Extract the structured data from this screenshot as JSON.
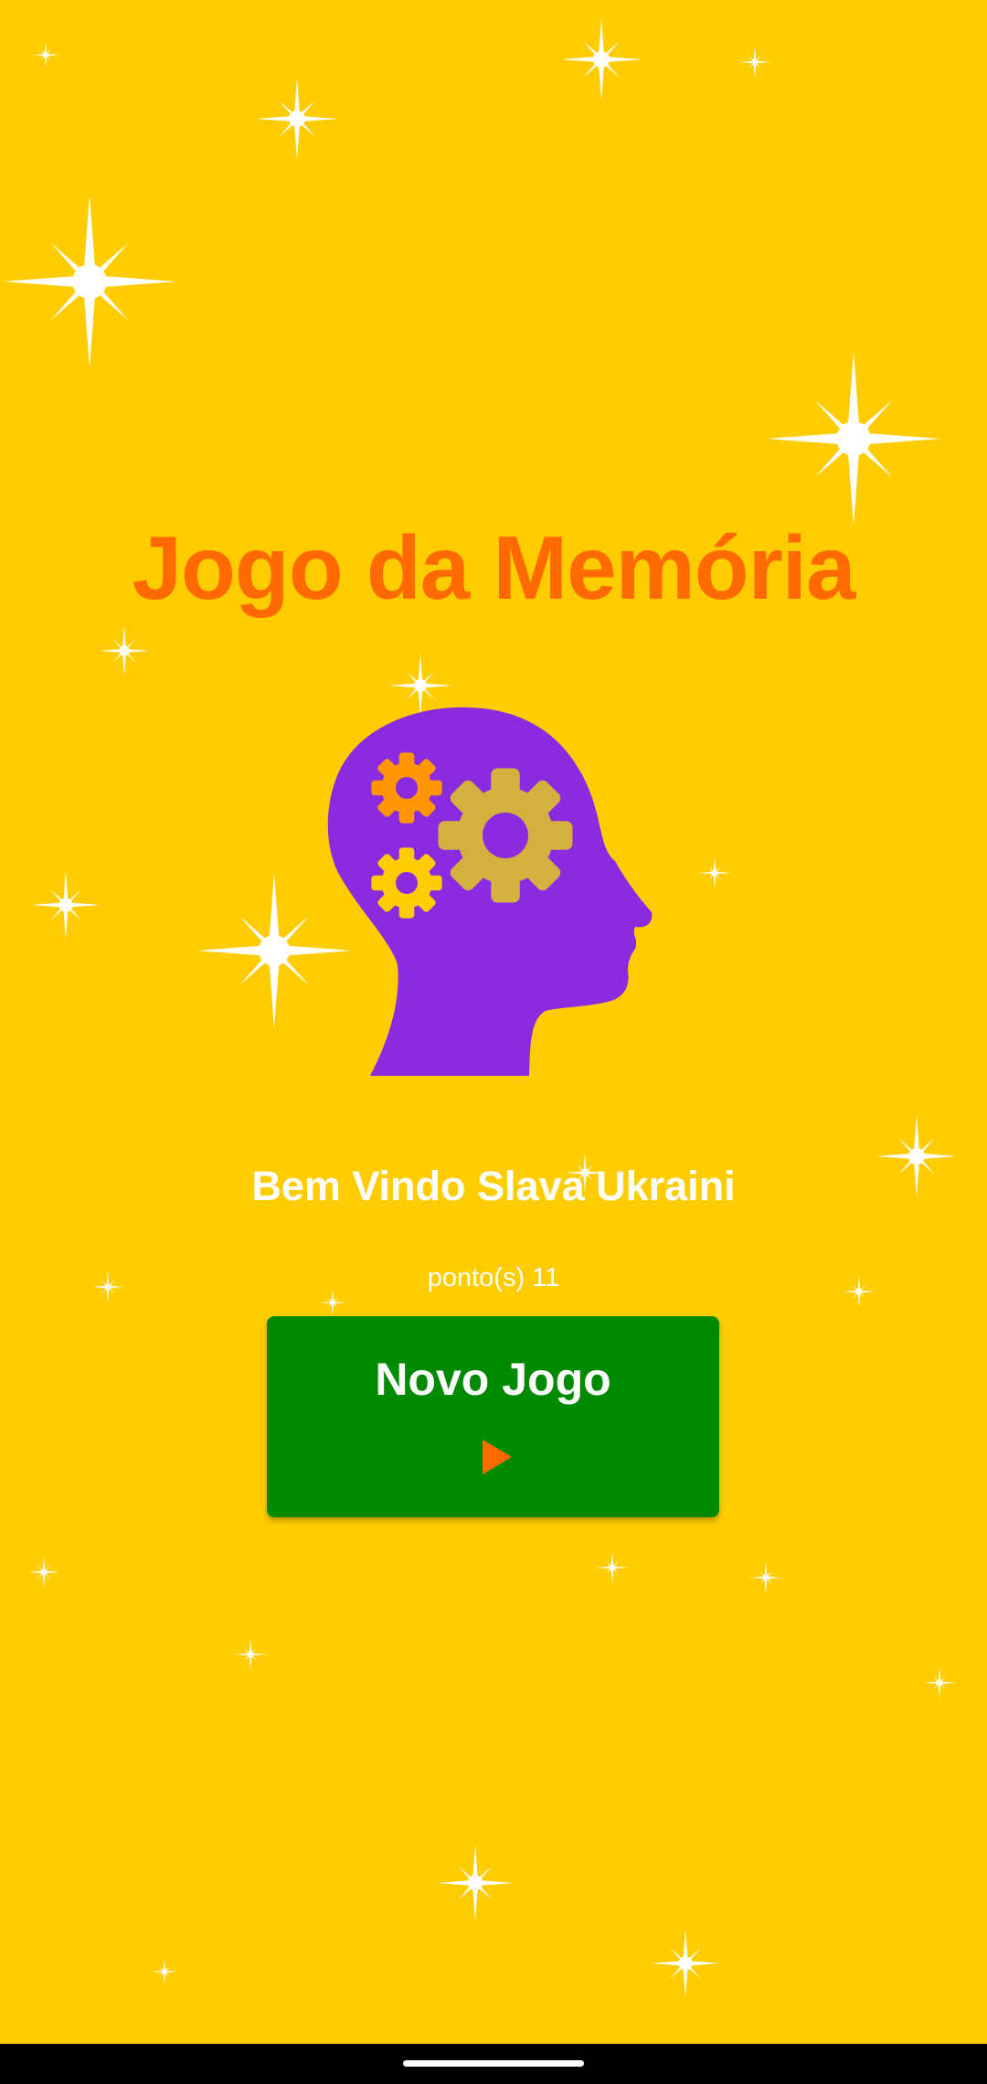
{
  "app": {
    "title": "Jogo da Memória",
    "welcome_text": "Bem Vindo Slava Ukraini",
    "points_text": "ponto(s) 11",
    "new_game_label": "Novo Jogo"
  },
  "icons": {
    "hero": "head-with-gears-icon",
    "play": "play-icon",
    "decoration": "sparkle-icon"
  },
  "colors": {
    "background": "#FFCC00",
    "title": "#FF6A00",
    "head": "#8A2BE2",
    "gear_large": "#D4B13F",
    "gear_small_top": "#FF9500",
    "gear_small_bottom": "#FFCC00",
    "button": "#008A00",
    "text": "#FFFFFF"
  }
}
